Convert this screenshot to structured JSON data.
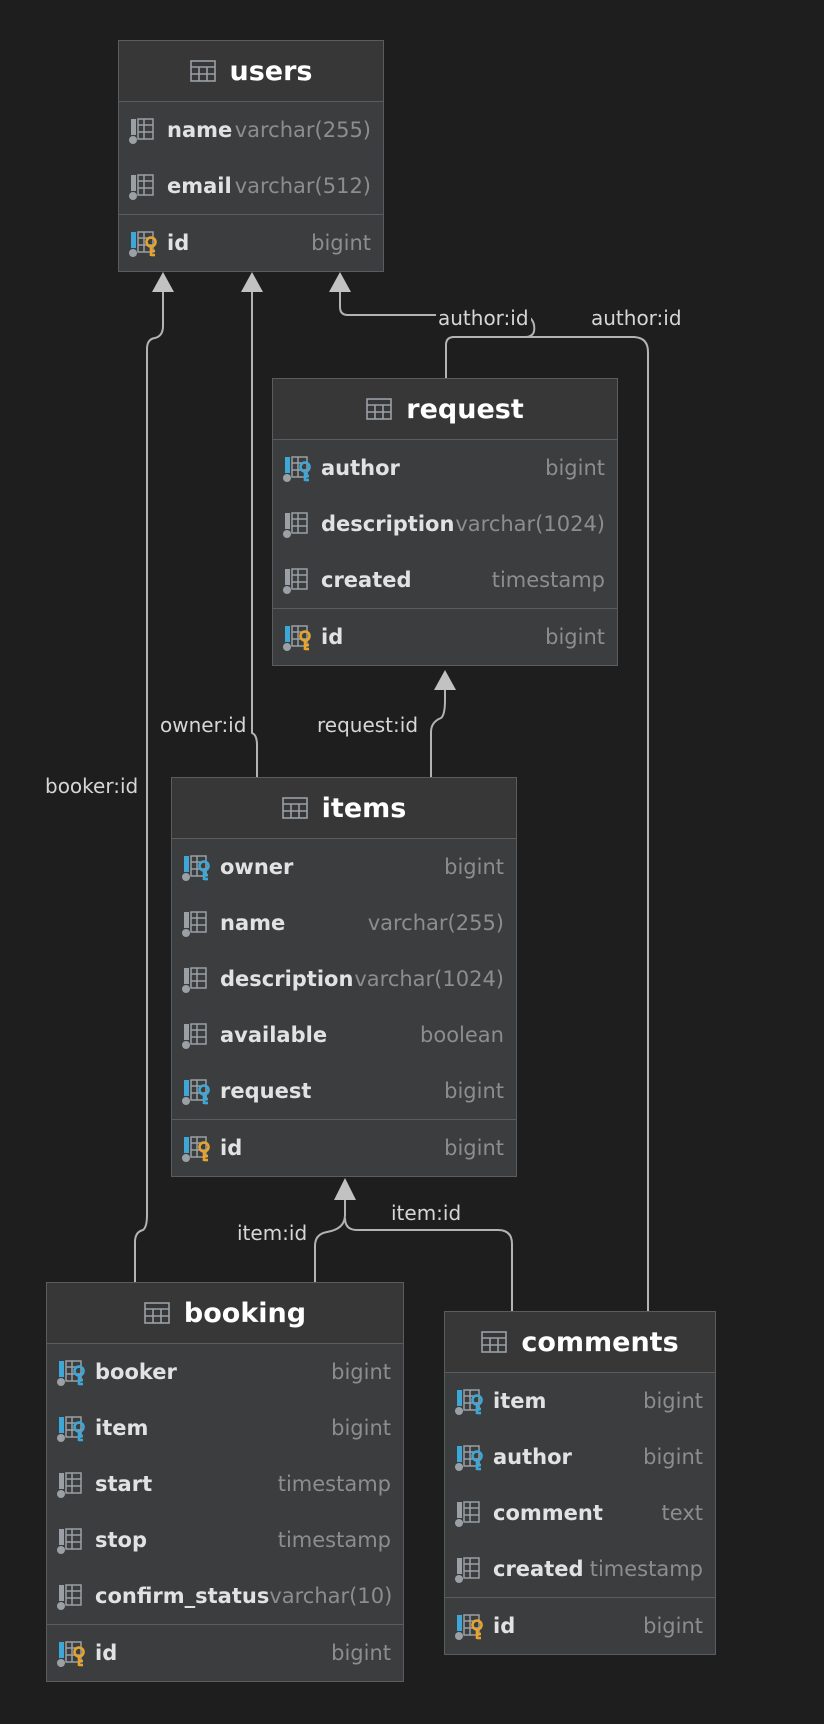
{
  "tables": {
    "users": {
      "name": "users",
      "columns": [
        {
          "name": "name",
          "type": "varchar(255)",
          "kind": "column"
        },
        {
          "name": "email",
          "type": "varchar(512)",
          "kind": "column"
        },
        {
          "name": "id",
          "type": "bigint",
          "kind": "pk"
        }
      ]
    },
    "request": {
      "name": "request",
      "columns": [
        {
          "name": "author",
          "type": "bigint",
          "kind": "fk"
        },
        {
          "name": "description",
          "type": "varchar(1024)",
          "kind": "column"
        },
        {
          "name": "created",
          "type": "timestamp",
          "kind": "column"
        },
        {
          "name": "id",
          "type": "bigint",
          "kind": "pk"
        }
      ]
    },
    "items": {
      "name": "items",
      "columns": [
        {
          "name": "owner",
          "type": "bigint",
          "kind": "fk"
        },
        {
          "name": "name",
          "type": "varchar(255)",
          "kind": "column"
        },
        {
          "name": "description",
          "type": "varchar(1024)",
          "kind": "column"
        },
        {
          "name": "available",
          "type": "boolean",
          "kind": "column"
        },
        {
          "name": "request",
          "type": "bigint",
          "kind": "fk"
        },
        {
          "name": "id",
          "type": "bigint",
          "kind": "pk"
        }
      ]
    },
    "booking": {
      "name": "booking",
      "columns": [
        {
          "name": "booker",
          "type": "bigint",
          "kind": "fk"
        },
        {
          "name": "item",
          "type": "bigint",
          "kind": "fk"
        },
        {
          "name": "start",
          "type": "timestamp",
          "kind": "column"
        },
        {
          "name": "stop",
          "type": "timestamp",
          "kind": "column"
        },
        {
          "name": "confirm_status",
          "type": "varchar(10)",
          "kind": "column"
        },
        {
          "name": "id",
          "type": "bigint",
          "kind": "pk"
        }
      ]
    },
    "comments": {
      "name": "comments",
      "columns": [
        {
          "name": "item",
          "type": "bigint",
          "kind": "fk"
        },
        {
          "name": "author",
          "type": "bigint",
          "kind": "fk"
        },
        {
          "name": "comment",
          "type": "text",
          "kind": "column"
        },
        {
          "name": "created",
          "type": "timestamp",
          "kind": "column"
        },
        {
          "name": "id",
          "type": "bigint",
          "kind": "pk"
        }
      ]
    }
  },
  "links": {
    "request_author": "author:id",
    "comments_author": "author:id",
    "items_owner": "owner:id",
    "items_request": "request:id",
    "booking_booker": "booker:id",
    "booking_item": "item:id",
    "comments_item": "item:id"
  },
  "colors": {
    "background": "#1e1e1e",
    "table_body": "#3b3d3f",
    "table_header": "#373737",
    "line": "#b3b3b3",
    "fk_key": "#3da8d8",
    "pk_key": "#e6a42c"
  }
}
